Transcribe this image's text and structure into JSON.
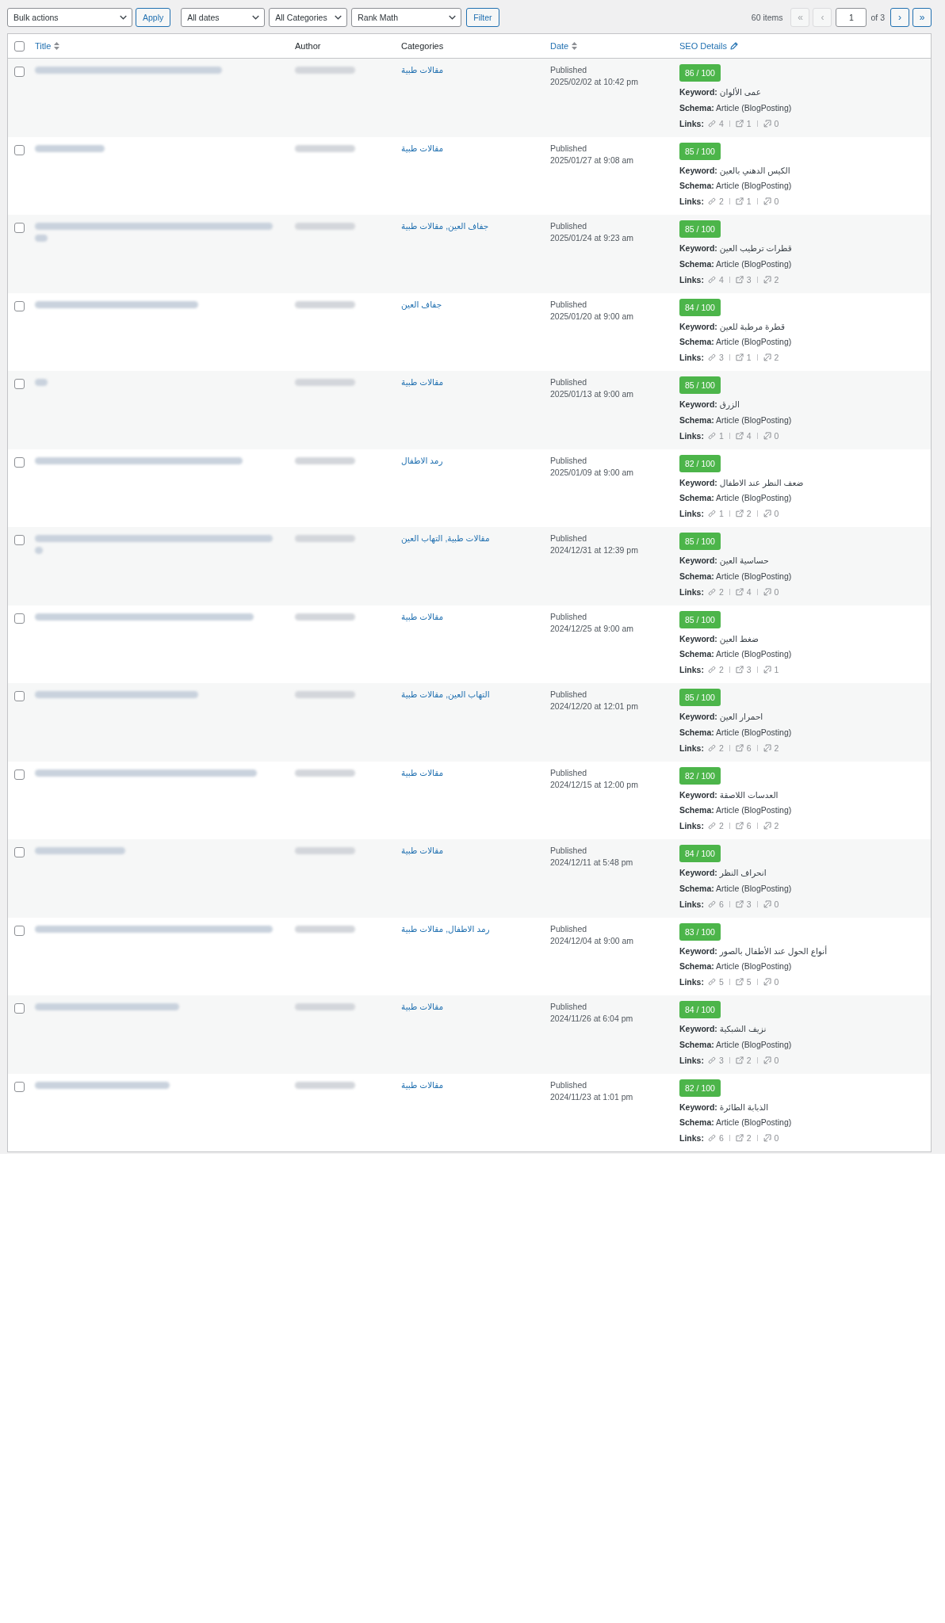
{
  "toolbar": {
    "bulk_actions": {
      "value": "Bulk actions"
    },
    "apply_button": "Apply",
    "filters": [
      {
        "value": "All dates"
      },
      {
        "value": "All Categories"
      },
      {
        "value": "Rank Math"
      }
    ],
    "filter_button": "Filter"
  },
  "pagination": {
    "count": "60 items",
    "first": {
      "label": "«",
      "disabled": true
    },
    "previous": {
      "label": "‹",
      "disabled": true
    },
    "page_input": {
      "value": "1"
    },
    "total": "of 3",
    "next": {
      "label": "›",
      "disabled": false
    },
    "last": {
      "label": "»",
      "disabled": false
    }
  },
  "table": {
    "select_all": {
      "checked": false
    },
    "columns": [
      {
        "label": "Title",
        "kind": "sortable"
      },
      {
        "label": "Author",
        "kind": "plain"
      },
      {
        "label": "Categories",
        "kind": "plain"
      },
      {
        "label": "Date",
        "kind": "sortable"
      },
      {
        "label": "SEO Details",
        "kind": "editable"
      }
    ],
    "rows": [
      {
        "selected": false,
        "categories": "مقالات طبية",
        "status": "Published",
        "date": "2025/02/02 at 10:42 pm",
        "score": "86 / 100",
        "keyword": "**Keyword:** عمى الألوان",
        "schema": "**Schema:** Article (BlogPosting)",
        "links_label": "Links:",
        "links": [
          {
            "kind": "internal",
            "count": "4"
          },
          {
            "kind": "external",
            "count": "1"
          },
          {
            "kind": "incoming",
            "count": "0"
          }
        ]
      },
      {
        "selected": false,
        "categories": "مقالات طبية",
        "status": "Published",
        "date": "2025/01/27 at 9:08 am",
        "score": "85 / 100",
        "keyword": "**Keyword:** الكيس الدهني بالعين",
        "schema": "**Schema:** Article (BlogPosting)",
        "links_label": "Links:",
        "links": [
          {
            "kind": "internal",
            "count": "2"
          },
          {
            "kind": "external",
            "count": "1"
          },
          {
            "kind": "incoming",
            "count": "0"
          }
        ]
      },
      {
        "selected": false,
        "categories": "جفاف العين, مقالات طبية",
        "status": "Published",
        "date": "2025/01/24 at 9:23 am",
        "score": "85 / 100",
        "keyword": "**Keyword:** قطرات ترطيب العين",
        "schema": "**Schema:** Article (BlogPosting)",
        "links_label": "Links:",
        "links": [
          {
            "kind": "internal",
            "count": "4"
          },
          {
            "kind": "external",
            "count": "3"
          },
          {
            "kind": "incoming",
            "count": "2"
          }
        ]
      },
      {
        "selected": false,
        "categories": "جفاف العين",
        "status": "Published",
        "date": "2025/01/20 at 9:00 am",
        "score": "84 / 100",
        "keyword": "**Keyword:** قطرة مرطبة للعين",
        "schema": "**Schema:** Article (BlogPosting)",
        "links_label": "Links:",
        "links": [
          {
            "kind": "internal",
            "count": "3"
          },
          {
            "kind": "external",
            "count": "1"
          },
          {
            "kind": "incoming",
            "count": "2"
          }
        ]
      },
      {
        "selected": false,
        "categories": "مقالات طبية",
        "status": "Published",
        "date": "2025/01/13 at 9:00 am",
        "score": "85 / 100",
        "keyword": "**Keyword:** الزرق",
        "schema": "**Schema:** Article (BlogPosting)",
        "links_label": "Links:",
        "links": [
          {
            "kind": "internal",
            "count": "1"
          },
          {
            "kind": "external",
            "count": "4"
          },
          {
            "kind": "incoming",
            "count": "0"
          }
        ]
      },
      {
        "selected": false,
        "categories": "رمد الاطفال",
        "status": "Published",
        "date": "2025/01/09 at 9:00 am",
        "score": "82 / 100",
        "keyword": "**Keyword:** ضعف النظر عند الاطفال",
        "schema": "**Schema:** Article (BlogPosting)",
        "links_label": "Links:",
        "links": [
          {
            "kind": "internal",
            "count": "1"
          },
          {
            "kind": "external",
            "count": "2"
          },
          {
            "kind": "incoming",
            "count": "0"
          }
        ]
      },
      {
        "selected": false,
        "categories": "مقالات طبية, التهاب العين",
        "status": "Published",
        "date": "2024/12/31 at 12:39 pm",
        "score": "85 / 100",
        "keyword": "**Keyword:** حساسية العين",
        "schema": "**Schema:** Article (BlogPosting)",
        "links_label": "Links:",
        "links": [
          {
            "kind": "internal",
            "count": "2"
          },
          {
            "kind": "external",
            "count": "4"
          },
          {
            "kind": "incoming",
            "count": "0"
          }
        ]
      },
      {
        "selected": false,
        "categories": "مقالات طبية",
        "status": "Published",
        "date": "2024/12/25 at 9:00 am",
        "score": "85 / 100",
        "keyword": "**Keyword:** ضغط العين",
        "schema": "**Schema:** Article (BlogPosting)",
        "links_label": "Links:",
        "links": [
          {
            "kind": "internal",
            "count": "2"
          },
          {
            "kind": "external",
            "count": "3"
          },
          {
            "kind": "incoming",
            "count": "1"
          }
        ]
      },
      {
        "selected": false,
        "categories": "التهاب العين, مقالات طبية",
        "status": "Published",
        "date": "2024/12/20 at 12:01 pm",
        "score": "85 / 100",
        "keyword": "**Keyword:** احمرار العين",
        "schema": "**Schema:** Article (BlogPosting)",
        "links_label": "Links:",
        "links": [
          {
            "kind": "internal",
            "count": "2"
          },
          {
            "kind": "external",
            "count": "6"
          },
          {
            "kind": "incoming",
            "count": "2"
          }
        ]
      },
      {
        "selected": false,
        "categories": "مقالات طبية",
        "status": "Published",
        "date": "2024/12/15 at 12:00 pm",
        "score": "82 / 100",
        "keyword": "**Keyword:** العدسات اللاصقة",
        "schema": "**Schema:** Article (BlogPosting)",
        "links_label": "Links:",
        "links": [
          {
            "kind": "internal",
            "count": "2"
          },
          {
            "kind": "external",
            "count": "6"
          },
          {
            "kind": "incoming",
            "count": "2"
          }
        ]
      },
      {
        "selected": false,
        "categories": "مقالات طبية",
        "status": "Published",
        "date": "2024/12/11 at 5:48 pm",
        "score": "84 / 100",
        "keyword": "**Keyword:** انحراف النظر",
        "schema": "**Schema:** Article (BlogPosting)",
        "links_label": "Links:",
        "links": [
          {
            "kind": "internal",
            "count": "6"
          },
          {
            "kind": "external",
            "count": "3"
          },
          {
            "kind": "incoming",
            "count": "0"
          }
        ]
      },
      {
        "selected": false,
        "categories": "رمد الاطفال, مقالات طبية",
        "status": "Published",
        "date": "2024/12/04 at 9:00 am",
        "score": "83 / 100",
        "keyword": "**Keyword:** أنواع الحول عند الأطفال بالصور",
        "schema": "**Schema:** Article (BlogPosting)",
        "links_label": "Links:",
        "links": [
          {
            "kind": "internal",
            "count": "5"
          },
          {
            "kind": "external",
            "count": "5"
          },
          {
            "kind": "incoming",
            "count": "0"
          }
        ]
      },
      {
        "selected": false,
        "categories": "مقالات طبية",
        "status": "Published",
        "date": "2024/11/26 at 6:04 pm",
        "score": "84 / 100",
        "keyword": "**Keyword:** نزيف الشبكية",
        "schema": "**Schema:** Article (BlogPosting)",
        "links_label": "Links:",
        "links": [
          {
            "kind": "internal",
            "count": "3"
          },
          {
            "kind": "external",
            "count": "2"
          },
          {
            "kind": "incoming",
            "count": "0"
          }
        ]
      },
      {
        "selected": false,
        "categories": "مقالات طبية",
        "status": "Published",
        "date": "2024/11/23 at 1:01 pm",
        "score": "82 / 100",
        "keyword": "**Keyword:** الذبابة الطائرة",
        "schema": "**Schema:** Article (BlogPosting)",
        "links_label": "Links:",
        "links": [
          {
            "kind": "internal",
            "count": "6"
          },
          {
            "kind": "external",
            "count": "2"
          },
          {
            "kind": "incoming",
            "count": "0"
          }
        ]
      }
    ]
  }
}
